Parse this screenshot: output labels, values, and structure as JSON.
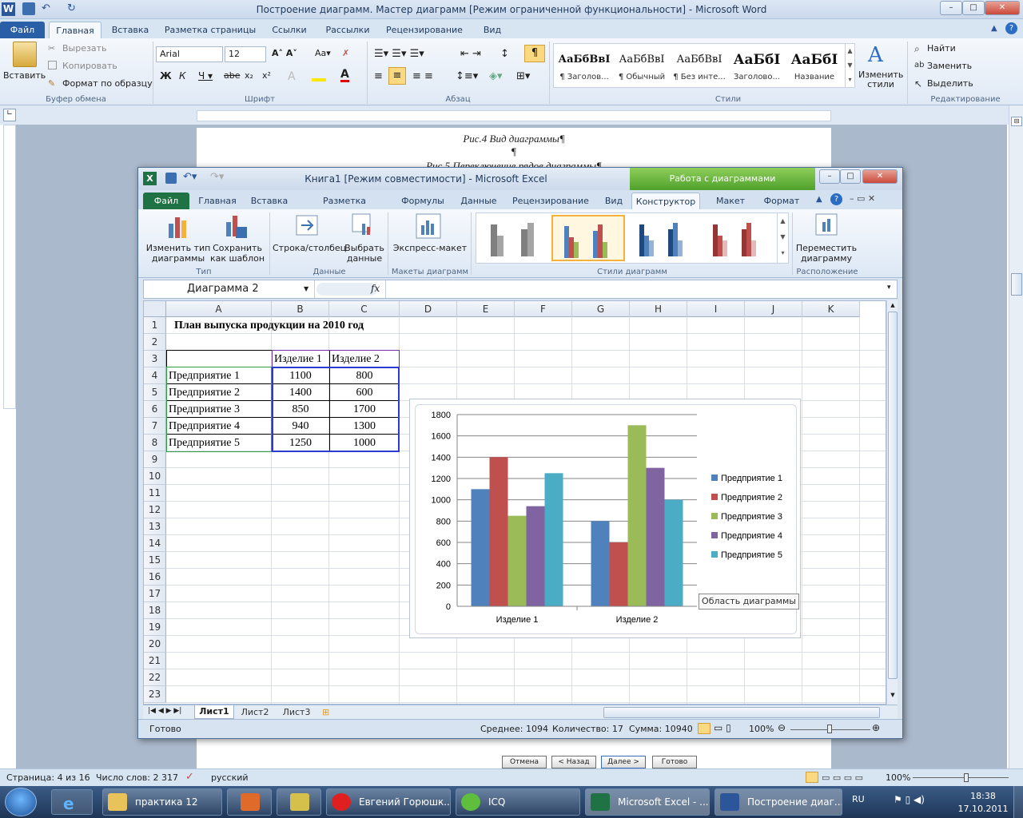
{
  "word": {
    "title": "Построение диаграмм. Мастер диаграмм [Режим ограниченной функциональности]  -  Microsoft Word",
    "tabs": [
      "Файл",
      "Главная",
      "Вставка",
      "Разметка страницы",
      "Ссылки",
      "Рассылки",
      "Рецензирование",
      "Вид"
    ],
    "clipboard": {
      "paste": "Вставить",
      "cut": "Вырезать",
      "copy": "Копировать",
      "format": "Формат по образцу",
      "label": "Буфер обмена"
    },
    "font": {
      "name": "Arial",
      "size": "12",
      "label": "Шрифт"
    },
    "paragraph_label": "Абзац",
    "styles": [
      {
        "sample": "АаБбВвI",
        "name": "¶ Заголов..."
      },
      {
        "sample": "АаБбВвI",
        "name": "¶ Обычный"
      },
      {
        "sample": "АаБбВвI",
        "name": "¶ Без инте..."
      },
      {
        "sample": "АаБбІ",
        "name": "Заголово..."
      },
      {
        "sample": "АаБбІ",
        "name": "Название"
      }
    ],
    "styles_label": "Стили",
    "change_styles": "Изменить стили",
    "editing": {
      "find": "Найти",
      "replace": "Заменить",
      "select": "Выделить",
      "label": "Редактирование"
    },
    "doc_lines": [
      "Рис.4 Вид диаграммы¶",
      "¶",
      "Рис.5 Переключение рядов диаграммы¶"
    ],
    "status": {
      "page": "Страница: 4 из 16",
      "words": "Число слов: 2 317",
      "lang": "русский",
      "zoom": "100%"
    },
    "wizard_buttons": [
      "Отмена",
      "< Назад",
      "Далее >",
      "Готово"
    ]
  },
  "excel": {
    "title": "Книга1  [Режим совместимости]  -  Microsoft Excel",
    "context": "Работа с диаграммами",
    "tabs": [
      "Файл",
      "Главная",
      "Вставка",
      "Разметка страницы",
      "Формулы",
      "Данные",
      "Рецензирование",
      "Вид",
      "Конструктор",
      "Макет",
      "Формат"
    ],
    "ribbon": {
      "change_type": "Изменить тип диаграммы",
      "save_template": "Сохранить как шаблон",
      "type_label": "Тип",
      "row_col": "Строка/столбец",
      "select_data": "Выбрать данные",
      "data_label": "Данные",
      "quick_layout": "Экспресс-макет",
      "layouts_label": "Макеты диаграмм",
      "styles_label": "Стили диаграмм",
      "move": "Переместить диаграмму",
      "location_label": "Расположение"
    },
    "name_box": "Диаграмма 2",
    "fx": "fx",
    "columns": [
      "A",
      "B",
      "C",
      "D",
      "E",
      "F",
      "G",
      "H",
      "I",
      "J",
      "K"
    ],
    "rows": [
      "1",
      "2",
      "3",
      "4",
      "5",
      "6",
      "7",
      "8",
      "9",
      "10",
      "11",
      "12",
      "13",
      "14",
      "15",
      "16",
      "17",
      "18",
      "19",
      "20",
      "21",
      "22",
      "23"
    ],
    "table": {
      "title": "План выпуска продукции на 2010 год",
      "headers": [
        "Изделие 1",
        "Изделие 2"
      ],
      "data": [
        [
          "Предприятие 1",
          "1100",
          "800"
        ],
        [
          "Предприятие 2",
          "1400",
          "600"
        ],
        [
          "Предприятие 3",
          "850",
          "1700"
        ],
        [
          "Предприятие 4",
          "940",
          "1300"
        ],
        [
          "Предприятие 5",
          "1250",
          "1000"
        ]
      ]
    },
    "sheets": [
      "Лист1",
      "Лист2",
      "Лист3"
    ],
    "status": {
      "ready": "Готово",
      "avg": "Среднее: 1094",
      "count": "Количество: 17",
      "sum": "Сумма: 10940",
      "zoom": "100%"
    },
    "tooltip": "Область диаграммы"
  },
  "chart_data": {
    "type": "bar",
    "categories": [
      "Изделие  1",
      "Изделие  2"
    ],
    "series": [
      {
        "name": "Предприятие  1",
        "values": [
          1100,
          800
        ],
        "color": "#4f81bd"
      },
      {
        "name": "Предприятие  2",
        "values": [
          1400,
          600
        ],
        "color": "#c0504d"
      },
      {
        "name": "Предприятие  3",
        "values": [
          850,
          1700
        ],
        "color": "#9bbb59"
      },
      {
        "name": "Предприятие  4",
        "values": [
          940,
          1300
        ],
        "color": "#8064a2"
      },
      {
        "name": "Предприятие  5",
        "values": [
          1250,
          1000
        ],
        "color": "#4bacc6"
      }
    ],
    "ylim": [
      0,
      1800
    ],
    "yticks": [
      0,
      200,
      400,
      600,
      800,
      1000,
      1200,
      1400,
      1600,
      1800
    ],
    "grid": true,
    "legend": "right"
  },
  "taskbar": {
    "items": [
      "практика 12",
      "",
      "Евгений Горюшк...",
      "ICQ",
      "Microsoft Excel - ...",
      "Построение диаг..."
    ],
    "lang": "RU",
    "time": "18:38",
    "date": "17.10.2011"
  }
}
